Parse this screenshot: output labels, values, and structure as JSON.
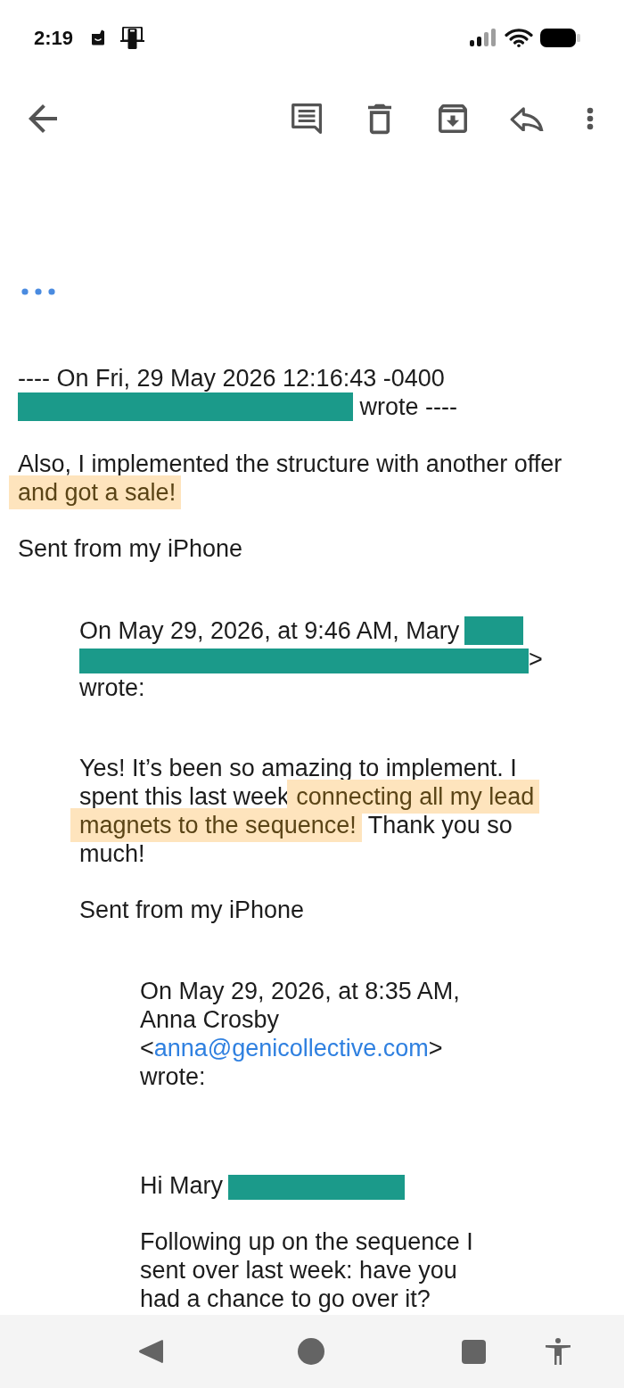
{
  "status_bar": {
    "time": "2:19"
  },
  "message": {
    "header": [
      {
        "kind": "text",
        "text": "---- On Fri, 29 May 2026 12:16:43 -0400 "
      },
      {
        "kind": "redaction"
      },
      {
        "kind": "text",
        "text": " wrote ----"
      }
    ],
    "paragraphs": [
      [
        {
          "kind": "text",
          "text": "Also, I implemented the structure with another offer "
        },
        {
          "kind": "highlight",
          "text": "and got a sale!"
        }
      ],
      [
        {
          "kind": "text",
          "text": "Sent from my iPhone"
        }
      ]
    ],
    "quote": {
      "header": [
        {
          "kind": "text",
          "text": "On May 29, 2026, at 9:46 AM, Mary"
        },
        {
          "kind": "redaction"
        },
        {
          "kind": "redaction"
        },
        {
          "kind": "text",
          "text": "> wrote:"
        }
      ],
      "paragraphs": [
        [
          {
            "kind": "text",
            "text": "Yes! It’s been so amazing to implement. I spent this last week "
          },
          {
            "kind": "highlight",
            "text": "connecting all my lead"
          },
          {
            "kind": "highlight",
            "text": "magnets to the sequence!"
          },
          {
            "kind": "text",
            "text": " Thank you so much!"
          }
        ],
        [
          {
            "kind": "text",
            "text": "Sent from my iPhone"
          }
        ]
      ],
      "quote": {
        "header": [
          {
            "kind": "text",
            "text": "On May 29, 2026, at 8:35 AM, Anna Crosby <"
          },
          {
            "kind": "link",
            "text": "anna@genicollective.com"
          },
          {
            "kind": "text",
            "text": "> wrote:"
          }
        ],
        "paragraphs": [
          [
            {
              "kind": "text",
              "text": "Hi Mary"
            },
            {
              "kind": "redaction"
            }
          ],
          [
            {
              "kind": "text",
              "text": "Following up on the sequence I sent over last week: have you had a chance to go over it?"
            }
          ]
        ]
      }
    }
  }
}
